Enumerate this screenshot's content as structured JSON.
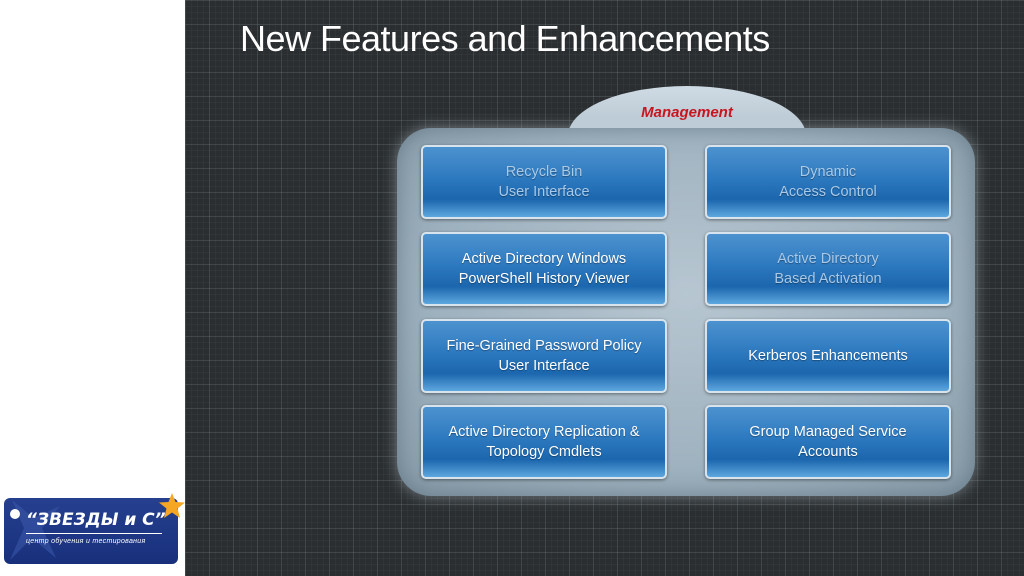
{
  "slide": {
    "title": "New Features and Enhancements",
    "section_label": "Management"
  },
  "features": [
    {
      "line1": "Recycle Bin",
      "line2": "User Interface",
      "emphasis": "dim"
    },
    {
      "line1": "Dynamic",
      "line2": "Access Control",
      "emphasis": "dim"
    },
    {
      "line1": "Active Directory Windows",
      "line2": "PowerShell History Viewer",
      "emphasis": "bright"
    },
    {
      "line1": "Active Directory",
      "line2": "Based Activation",
      "emphasis": "dim"
    },
    {
      "line1": "Fine-Grained Password Policy",
      "line2": "User Interface",
      "emphasis": "bright"
    },
    {
      "line1": "Kerberos Enhancements",
      "line2": "",
      "emphasis": "bright"
    },
    {
      "line1": "Active Directory Replication &",
      "line2": "Topology Cmdlets",
      "emphasis": "bright"
    },
    {
      "line1": "Group Managed Service",
      "line2": "Accounts",
      "emphasis": "bright"
    }
  ],
  "logo": {
    "name": "“ЗВЕЗДЫ и С”",
    "tagline": "центр обучения и тестирования"
  },
  "colors": {
    "background": "#2a2e30",
    "panel": "#a9bac6",
    "tile": "#2d79bf",
    "section_label": "#c8141e",
    "logo_bg": "#1f3886",
    "star": "#f5a623"
  }
}
